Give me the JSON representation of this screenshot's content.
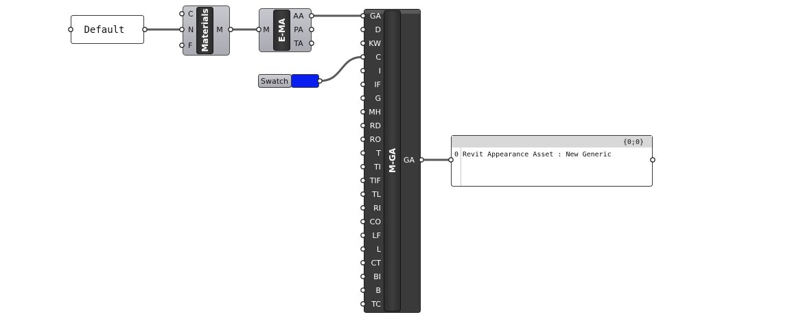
{
  "panel_default": {
    "text": "Default"
  },
  "materials": {
    "title": "Materials",
    "inputs": [
      "C",
      "N",
      "F"
    ],
    "outputs": [
      "M"
    ]
  },
  "ema": {
    "title": "E-MA",
    "inputs": [
      "M"
    ],
    "outputs": [
      "AA",
      "PA",
      "TA"
    ]
  },
  "swatch": {
    "label": "Swatch",
    "color": "#0a1ef0"
  },
  "mga": {
    "title": "M-GA",
    "inputs": [
      "GA",
      "D",
      "KW",
      "C",
      "I",
      "IF",
      "G",
      "MH",
      "RD",
      "RO",
      "T",
      "TI",
      "TIF",
      "TL",
      "RI",
      "CO",
      "LF",
      "L",
      "CT",
      "BI",
      "B",
      "TC"
    ],
    "outputs": [
      "GA"
    ]
  },
  "output_panel": {
    "path": "{0;0}",
    "rows": [
      {
        "index": "0",
        "text": "Revit Appearance Asset : New Generic"
      }
    ]
  }
}
